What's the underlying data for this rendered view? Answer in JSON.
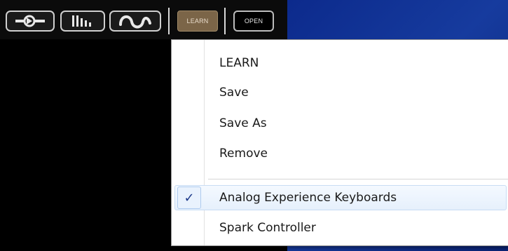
{
  "colors": {
    "menu_bg": "#ffffff",
    "check_color": "#1d3a8a",
    "learn_button_bg": "#7b6548",
    "desktop_bg": "#163b9e"
  },
  "toolbar": {
    "icons": [
      "input-plug-icon",
      "bars-meter-icon",
      "wave-icon"
    ],
    "learn_label": "LEARN",
    "open_label": "OPEN"
  },
  "menu": {
    "items": [
      {
        "label": "LEARN",
        "checked": false
      },
      {
        "label": "Save",
        "checked": false
      },
      {
        "label": "Save As",
        "checked": false
      },
      {
        "label": "Remove",
        "checked": false
      },
      {
        "label": "Analog Experience Keyboards",
        "checked": true
      },
      {
        "label": "Spark Controller",
        "checked": false
      }
    ],
    "check_glyph": "✓"
  }
}
